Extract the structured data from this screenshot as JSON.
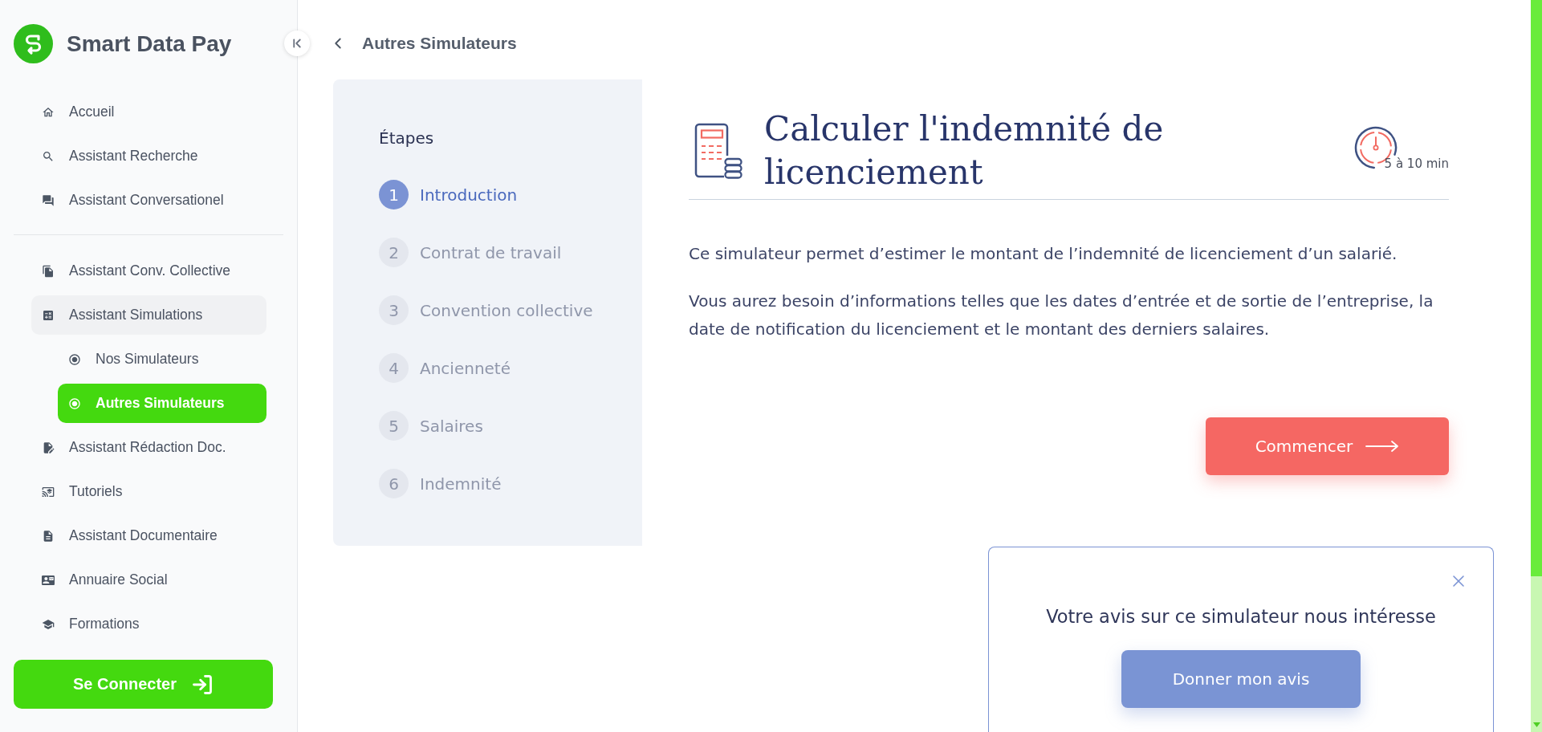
{
  "sidebar": {
    "brand": "Smart Data Pay",
    "nav_groups": [
      {
        "items": [
          {
            "label": "Accueil",
            "selected": false
          },
          {
            "label": "Assistant Recherche",
            "selected": false
          },
          {
            "label": "Assistant Conversationel",
            "selected": false
          }
        ]
      },
      {
        "items": [
          {
            "label": "Assistant Conv. Collective",
            "selected": false
          },
          {
            "label": "Assistant Simulations",
            "selected": false,
            "children": [
              {
                "label": "Nos Simulateurs",
                "selected": false
              },
              {
                "label": "Autres Simulateurs",
                "selected": true
              }
            ]
          },
          {
            "label": "Assistant Rédaction Doc.",
            "selected": false
          },
          {
            "label": "Tutoriels",
            "selected": false
          },
          {
            "label": "Assistant Documentaire",
            "selected": false
          },
          {
            "label": "Annuaire Social",
            "selected": false
          },
          {
            "label": "Formations",
            "selected": false
          }
        ]
      }
    ],
    "login_button": "Se Connecter"
  },
  "header": {
    "title": "Autres Simulateurs"
  },
  "steps": {
    "title": "Étapes",
    "items": [
      {
        "number": "1",
        "label": "Introduction",
        "selected": true
      },
      {
        "number": "2",
        "label": "Contrat de travail",
        "selected": false
      },
      {
        "number": "3",
        "label": "Convention collective",
        "selected": false
      },
      {
        "number": "4",
        "label": "Ancienneté",
        "selected": false
      },
      {
        "number": "5",
        "label": "Salaires",
        "selected": false
      },
      {
        "number": "6",
        "label": "Indemnité",
        "selected": false
      }
    ]
  },
  "simulator": {
    "title": "Calculer l'indemnité de licenciement",
    "duration": "5 à 10 min",
    "paragraphs": [
      "Ce simulateur permet d’estimer le montant de l’indemnité de licenciement d’un salarié.",
      "Vous aurez besoin d’informations telles que les dates d’entrée et de sortie de l’entreprise, la date de notification du licenciement et le montant des derniers salaires."
    ],
    "start_button": "Commencer"
  },
  "feedback": {
    "title": "Votre avis sur ce simulateur nous intéresse",
    "button": "Donner mon avis"
  }
}
